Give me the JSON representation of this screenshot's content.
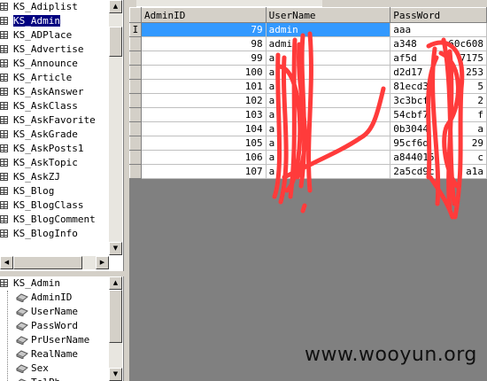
{
  "tables_tree": {
    "items": [
      {
        "label": "KS_Adiplist"
      },
      {
        "label": "KS_Admin"
      },
      {
        "label": "KS_ADPlace"
      },
      {
        "label": "KS_Advertise"
      },
      {
        "label": "KS_Announce"
      },
      {
        "label": "KS_Article"
      },
      {
        "label": "KS_AskAnswer"
      },
      {
        "label": "KS_AskClass"
      },
      {
        "label": "KS_AskFavorite"
      },
      {
        "label": "KS_AskGrade"
      },
      {
        "label": "KS_AskPosts1"
      },
      {
        "label": "KS_AskTopic"
      },
      {
        "label": "KS_AskZJ"
      },
      {
        "label": "KS_Blog"
      },
      {
        "label": "KS_BlogClass"
      },
      {
        "label": "KS_BlogComment"
      },
      {
        "label": "KS_BlogInfo"
      }
    ]
  },
  "fields_tree": {
    "root": "KS_Admin",
    "fields": [
      {
        "label": "AdminID"
      },
      {
        "label": "UserName"
      },
      {
        "label": "PassWord"
      },
      {
        "label": "PrUserName"
      },
      {
        "label": "RealName"
      },
      {
        "label": "Sex"
      },
      {
        "label": "TelPh"
      }
    ]
  },
  "grid": {
    "columns": [
      {
        "label": "AdminID"
      },
      {
        "label": "UserName"
      },
      {
        "label": "PassWord"
      }
    ],
    "current_row_marker": "I",
    "rows": [
      {
        "id": "79",
        "user": "admin",
        "pw": "aaa"
      },
      {
        "id": "98",
        "user": "admi",
        "pw": "a348"
      },
      {
        "id": "99",
        "user": "a",
        "pw": "af5d"
      },
      {
        "id": "100",
        "user": "a",
        "pw": "d2d17"
      },
      {
        "id": "101",
        "user": "a",
        "pw": "81ecd3"
      },
      {
        "id": "102",
        "user": "a",
        "pw": "3c3bcf"
      },
      {
        "id": "103",
        "user": "a",
        "pw": "54cbf7"
      },
      {
        "id": "104",
        "user": "a",
        "pw": "0b3044"
      },
      {
        "id": "105",
        "user": "a",
        "pw": "95cf6d"
      },
      {
        "id": "106",
        "user": "a",
        "pw": "a844015"
      },
      {
        "id": "107",
        "user": "a",
        "pw": "2a5cd9c"
      }
    ],
    "pw_suffixes": [
      "",
      "60c608",
      "7175",
      "253",
      "5",
      "2",
      "f",
      "a",
      "29",
      "c",
      "a1a"
    ]
  },
  "watermark": "www.wooyun.org",
  "colors": {
    "selection": "#3399ff",
    "tree_selection": "#000080",
    "scribble": "#ff3b3b"
  }
}
